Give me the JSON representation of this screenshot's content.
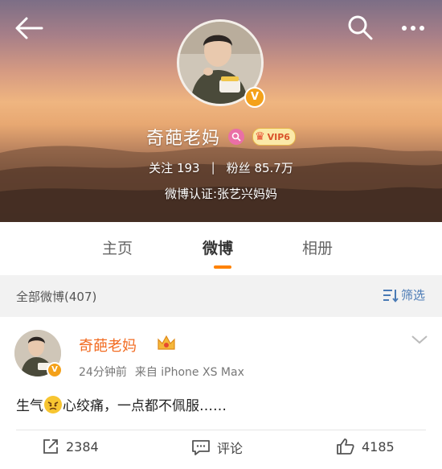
{
  "profile": {
    "name": "奇葩老妈",
    "vip_label": "VIP6",
    "follow_label": "关注",
    "follow_count": "193",
    "separator": "|",
    "fans_label": "粉丝",
    "fans_count": "85.7万",
    "certification": "微博认证:张艺兴妈妈"
  },
  "tabs": [
    {
      "label": "主页"
    },
    {
      "label": "微博"
    },
    {
      "label": "相册"
    }
  ],
  "filter_bar": {
    "all_label": "全部微博(407)",
    "filter_label": "筛选"
  },
  "post": {
    "author": "奇葩老妈",
    "time": "24分钟前",
    "source": "来自 iPhone XS Max",
    "text_before_emoji": "生气",
    "text_after_emoji": "心绞痛，一点都不佩服……",
    "repost_count": "2384",
    "comment_label": "评论",
    "like_count": "4185"
  },
  "icons": {
    "back": "arrow-left-icon",
    "search": "search-icon",
    "more": "more-icon",
    "verified": "verified-v-icon",
    "chevron": "chevron-down-icon"
  },
  "colors": {
    "accent": "#ff8200",
    "author_name": "#f26b21",
    "filter": "#4a7ab5",
    "verified": "#f4a11a"
  }
}
